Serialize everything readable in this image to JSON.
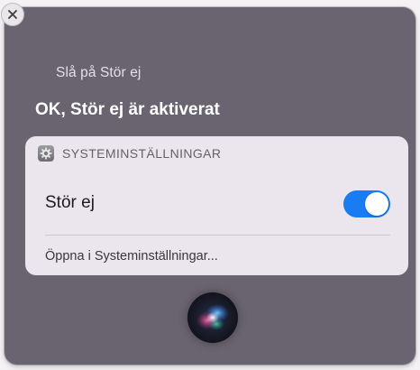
{
  "window": {
    "close_icon": "x-icon",
    "request": "Slå på Stör ej",
    "response": "OK, Stör ej är aktiverat"
  },
  "card": {
    "app_icon": "gear-icon",
    "app_name": "SYSTEMINSTÄLLNINGAR",
    "setting_label": "Stör ej",
    "toggle_on": true,
    "open_link": "Öppna i Systeminställningar..."
  },
  "colors": {
    "window_bg": "#6a6470",
    "card_bg": "#ebe5ed",
    "toggle_on": "#1a7cf3"
  },
  "siri_orb_icon": "siri-orb-icon"
}
